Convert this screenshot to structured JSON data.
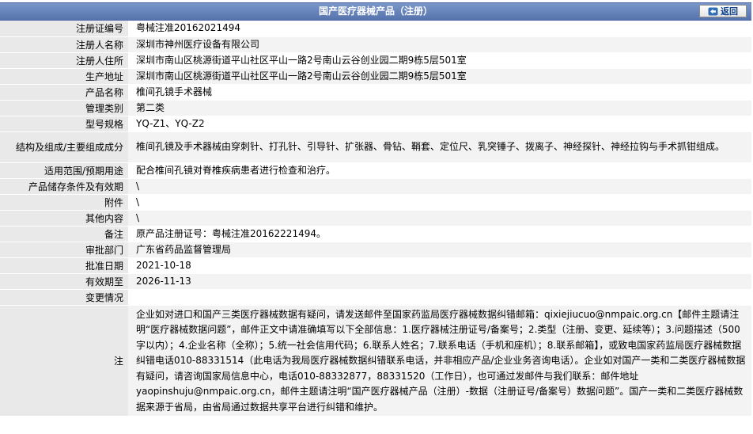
{
  "header": {
    "title": "国产医疗器械产品（注册）",
    "back_label": "返回"
  },
  "rows": [
    {
      "label": "注册证编号",
      "value": "粤械注准20162021494"
    },
    {
      "label": "注册人名称",
      "value": "深圳市神州医疗设备有限公司"
    },
    {
      "label": "注册人住所",
      "value": "深圳市南山区桃源街道平山社区平山一路2号南山云谷创业园二期9栋5层501室"
    },
    {
      "label": "生产地址",
      "value": "深圳市南山区桃源街道平山社区平山一路2号南山云谷创业园二期9栋5层501室"
    },
    {
      "label": "产品名称",
      "value": "椎间孔镜手术器械"
    },
    {
      "label": "管理类别",
      "value": "第二类"
    },
    {
      "label": "型号规格",
      "value": "YQ-Z1、YQ-Z2"
    },
    {
      "label": "结构及组成/主要组成成分",
      "value": "椎间孔镜及手术器械由穿刺针、打孔针、引导针、扩张器、骨钻、鞘套、定位尺、乳突锤子、拨离子、神经探针、神经拉钩与手术抓钳组成。"
    },
    {
      "label": "适用范围/预期用途",
      "value": "配合椎间孔镜对脊椎疾病患者进行检查和治疗。"
    },
    {
      "label": "产品储存条件及有效期",
      "value": "\\"
    },
    {
      "label": "附件",
      "value": "\\"
    },
    {
      "label": "其他内容",
      "value": "\\"
    },
    {
      "label": "备注",
      "value": "原产品注册证号：粤械注准20162221494。"
    },
    {
      "label": "审批部门",
      "value": "广东省药品监督管理局"
    },
    {
      "label": "批准日期",
      "value": "2021-10-18"
    },
    {
      "label": "有效期至",
      "value": "2026-11-13"
    },
    {
      "label": "变更情况",
      "value": ""
    }
  ],
  "note": {
    "label": "注",
    "text": "企业如对进口和国产三类医疗器械数据有疑问，请发送邮件至国家药监局医疗器械数据纠错邮箱：qixiejiucuo@nmpaic.org.cn【邮件主题请注明“医疗器械数据问题”，邮件正文中请准确填写以下全部信息：1.医疗器械注册证号/备案号；2.类型（注册、变更、延续等）；3.问题描述（500字以内）；4.企业名称（全称）；5.统一社会信用代码；6.联系人姓名；7.联系电话（手机和座机）；8.联系邮箱】，或致电国家药监局医疗器械数据纠错电话010-88331514（此电话为我局医疗器械数据纠错联系电话，并非相应产品/企业业务咨询电话）。企业如对国产一类和二类医疗器械数据有疑问，请咨询国家局信息中心，电话010-88332877，88331520（工作日），也可通过发邮件与我们联系：邮件地址yaopinshuju@nmpaic.org.cn，邮件主题请注明“国产医疗器械产品（注册）-数据（注册证号/备案号）数据问题”。国产一类和二类医疗器械数据来源于省局，由省局通过数据共享平台进行纠错和维护。"
  },
  "icons": {
    "back": "back-arrow-icon"
  },
  "colors": {
    "header_top": "#7a97c9",
    "header_bottom": "#5673ac",
    "label_bg": "#e9e9e9",
    "back_text": "#0b3f8c",
    "arrow": "#2f6db5"
  }
}
